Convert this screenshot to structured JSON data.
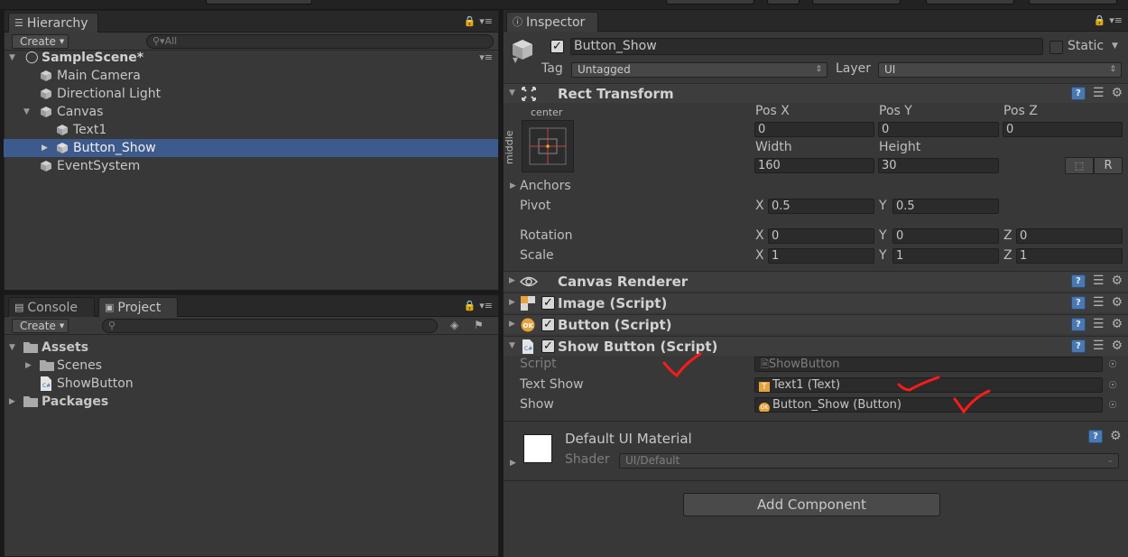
{
  "hierarchy": {
    "tab": "Hierarchy",
    "create": "Create",
    "search_placeholder": "All",
    "scene": "SampleScene*",
    "items": [
      "Main Camera",
      "Directional Light",
      "Canvas",
      "Text1",
      "Button_Show",
      "EventSystem"
    ]
  },
  "project": {
    "tabs": [
      "Console",
      "Project"
    ],
    "create": "Create",
    "tree": [
      "Assets",
      "Scenes",
      "ShowButton",
      "Packages"
    ]
  },
  "inspector": {
    "tab": "Inspector",
    "object_name": "Button_Show",
    "static_label": "Static",
    "tag_label": "Tag",
    "tag_value": "Untagged",
    "layer_label": "Layer",
    "layer_value": "UI",
    "rect": {
      "title": "Rect Transform",
      "anchor_h": "center",
      "anchor_v": "middle",
      "pos_x_label": "Pos X",
      "pos_y_label": "Pos Y",
      "pos_z_label": "Pos Z",
      "pos_x": "0",
      "pos_y": "0",
      "pos_z": "0",
      "width_label": "Width",
      "height_label": "Height",
      "width": "160",
      "height": "30",
      "r_button": "R",
      "anchors_label": "Anchors",
      "pivot_label": "Pivot",
      "pivot_x": "0.5",
      "pivot_y": "0.5",
      "rotation_label": "Rotation",
      "rot_x": "0",
      "rot_y": "0",
      "rot_z": "0",
      "scale_label": "Scale",
      "scale_x": "1",
      "scale_y": "1",
      "scale_z": "1",
      "x": "X",
      "y": "Y",
      "z": "Z"
    },
    "canvas_renderer": "Canvas Renderer",
    "image_script": "Image (Script)",
    "button_script": "Button (Script)",
    "show_button": {
      "title": "Show Button (Script)",
      "script_label": "Script",
      "script_value": "ShowButton",
      "text_show_label": "Text Show",
      "text_show_value": "Text1 (Text)",
      "show_label": "Show",
      "show_value": "Button_Show (Button)"
    },
    "material": {
      "title": "Default UI Material",
      "shader_label": "Shader",
      "shader_value": "UI/Default"
    },
    "add_component": "Add Component"
  },
  "colors": {
    "selection": "#3d5a8c",
    "panel": "#383838",
    "annotation_checkmark": "#ff1a1a"
  }
}
